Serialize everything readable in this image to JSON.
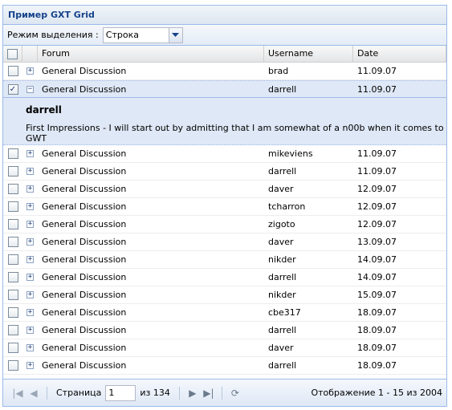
{
  "panel": {
    "title": "Пример GXT Grid"
  },
  "toolbar": {
    "selection_label": "Режим выделения :",
    "selection_value": "Строка"
  },
  "columns": {
    "forum": "Forum",
    "username": "Username",
    "date": "Date"
  },
  "rows": [
    {
      "forum": "General Discussion",
      "username": "brad",
      "date": "11.09.07",
      "checked": false,
      "expanded": false
    },
    {
      "forum": "General Discussion",
      "username": "darrell",
      "date": "11.09.07",
      "checked": true,
      "expanded": true
    },
    {
      "forum": "General Discussion",
      "username": "mikeviens",
      "date": "11.09.07",
      "checked": false,
      "expanded": false
    },
    {
      "forum": "General Discussion",
      "username": "darrell",
      "date": "11.09.07",
      "checked": false,
      "expanded": false
    },
    {
      "forum": "General Discussion",
      "username": "daver",
      "date": "12.09.07",
      "checked": false,
      "expanded": false
    },
    {
      "forum": "General Discussion",
      "username": "tcharron",
      "date": "12.09.07",
      "checked": false,
      "expanded": false
    },
    {
      "forum": "General Discussion",
      "username": "zigoto",
      "date": "12.09.07",
      "checked": false,
      "expanded": false
    },
    {
      "forum": "General Discussion",
      "username": "daver",
      "date": "13.09.07",
      "checked": false,
      "expanded": false
    },
    {
      "forum": "General Discussion",
      "username": "nikder",
      "date": "14.09.07",
      "checked": false,
      "expanded": false
    },
    {
      "forum": "General Discussion",
      "username": "darrell",
      "date": "14.09.07",
      "checked": false,
      "expanded": false
    },
    {
      "forum": "General Discussion",
      "username": "nikder",
      "date": "15.09.07",
      "checked": false,
      "expanded": false
    },
    {
      "forum": "General Discussion",
      "username": "cbe317",
      "date": "18.09.07",
      "checked": false,
      "expanded": false
    },
    {
      "forum": "General Discussion",
      "username": "darrell",
      "date": "18.09.07",
      "checked": false,
      "expanded": false
    },
    {
      "forum": "General Discussion",
      "username": "daver",
      "date": "18.09.07",
      "checked": false,
      "expanded": false
    },
    {
      "forum": "General Discussion",
      "username": "darrell",
      "date": "18.09.07",
      "checked": false,
      "expanded": false
    }
  ],
  "expanded": {
    "author": "darrell",
    "text": "First Impressions - I will start out by admitting that I am somewhat of a n00b when it comes to GWT"
  },
  "paging": {
    "page_label": "Страница",
    "page_value": "1",
    "of_label": "из 134",
    "display_text": "Отображение 1 - 15 из 2004"
  },
  "icons": {
    "checked_glyph": "✓",
    "expand_glyph": "+",
    "collapse_glyph": "−",
    "dropdown_glyph": "▼",
    "first_glyph": "|◀",
    "prev_glyph": "◀",
    "next_glyph": "▶",
    "last_glyph": "▶|",
    "refresh_glyph": "⟳"
  }
}
